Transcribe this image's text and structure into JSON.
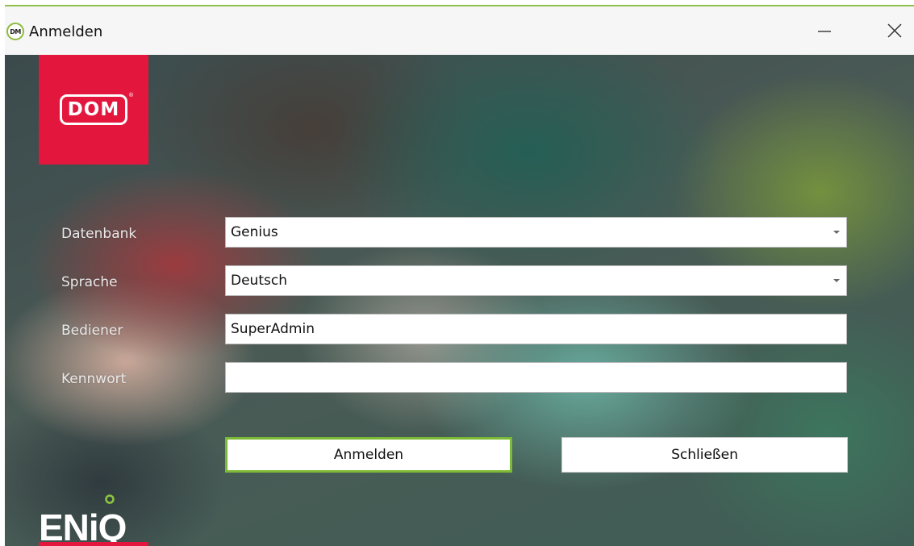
{
  "window": {
    "title": "Anmelden",
    "app_icon_text": "DM",
    "accent_color": "#8fc04a"
  },
  "brand": {
    "logo_text": "DOM",
    "logo_color": "#e3173e",
    "product_logo": "ENiQ"
  },
  "form": {
    "database": {
      "label": "Datenbank",
      "value": "Genius"
    },
    "language": {
      "label": "Sprache",
      "value": "Deutsch"
    },
    "operator": {
      "label": "Bediener",
      "value": "SuperAdmin"
    },
    "password": {
      "label": "Kennwort",
      "value": ""
    }
  },
  "buttons": {
    "login_label": "Anmelden",
    "close_label": "Schließen"
  },
  "icons": {
    "minimize": "minimize-icon",
    "close": "close-icon",
    "dropdown": "chevron-down-icon"
  }
}
